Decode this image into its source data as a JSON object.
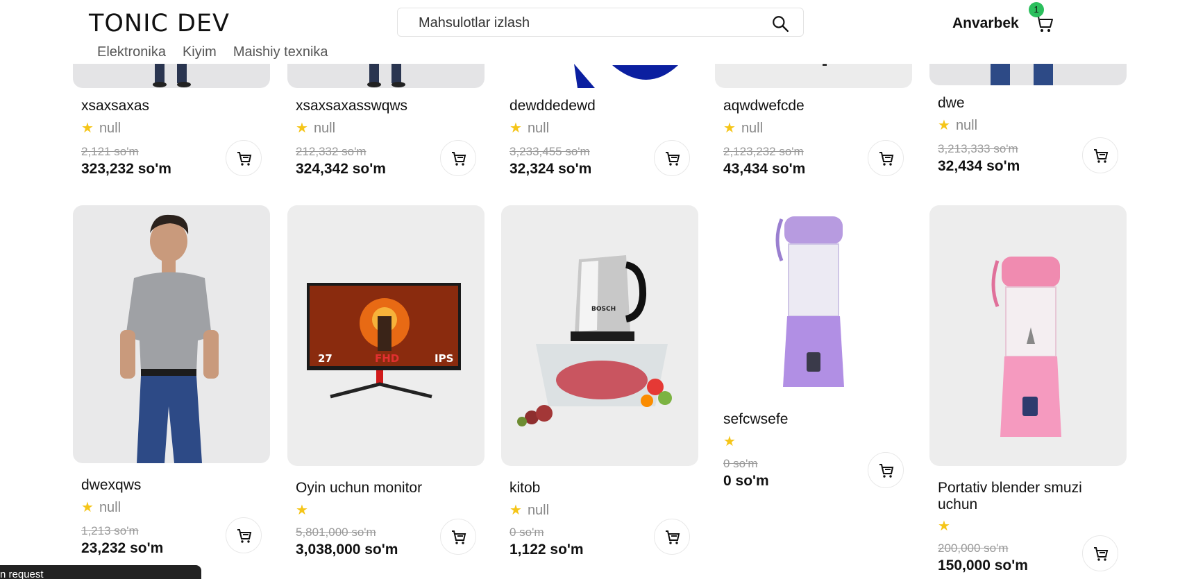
{
  "header": {
    "logo": "TONIC DEV",
    "categories": [
      "Elektronika",
      "Kiyim",
      "Maishiy texnika"
    ],
    "search_placeholder": "Mahsulotlar izlash",
    "user_name": "Anvarbek",
    "cart_count": "1"
  },
  "products_row1": [
    {
      "name": "xsaxsaxas",
      "rating": "null",
      "old_price": "2,121 so'm",
      "price": "323,232 so'm"
    },
    {
      "name": "xsaxsaxasswqws",
      "rating": "null",
      "old_price": "212,332 so'm",
      "price": "324,342 so'm"
    },
    {
      "name": "dewddedewd",
      "rating": "null",
      "old_price": "3,233,455 so'm",
      "price": "32,324 so'm"
    },
    {
      "name": "aqwdwefcde",
      "rating": "null",
      "old_price": "2,123,232 so'm",
      "price": "43,434 so'm"
    },
    {
      "name": "dwe",
      "rating": "null",
      "old_price": "3,213,333 so'm",
      "price": "32,434 so'm"
    }
  ],
  "products_row2": [
    {
      "name": "dwexqws",
      "rating": "null",
      "old_price": "1,213 so'm",
      "price": "23,232 so'm"
    },
    {
      "name": "Oyin uchun monitor",
      "rating": "",
      "old_price": "5,801,000 so'm",
      "price": "3,038,000 so'm",
      "monitor_labels": [
        "27",
        "FHD",
        "IPS"
      ]
    },
    {
      "name": "kitob",
      "rating": "null",
      "old_price": "0 so'm",
      "price": "1,122 so'm",
      "brand": "BOSCH"
    },
    {
      "name": "sefcwsefe",
      "rating": "",
      "old_price": "0 so'm",
      "price": "0 so'm"
    },
    {
      "name": "Portativ blender smuzi uchun",
      "rating": "",
      "old_price": "200,000 so'm",
      "price": "150,000 so'm"
    }
  ],
  "toast": {
    "text": "n request"
  },
  "colors": {
    "star": "#f5c518",
    "badge": "#2bbf5d",
    "card_bg": "#ededed"
  }
}
